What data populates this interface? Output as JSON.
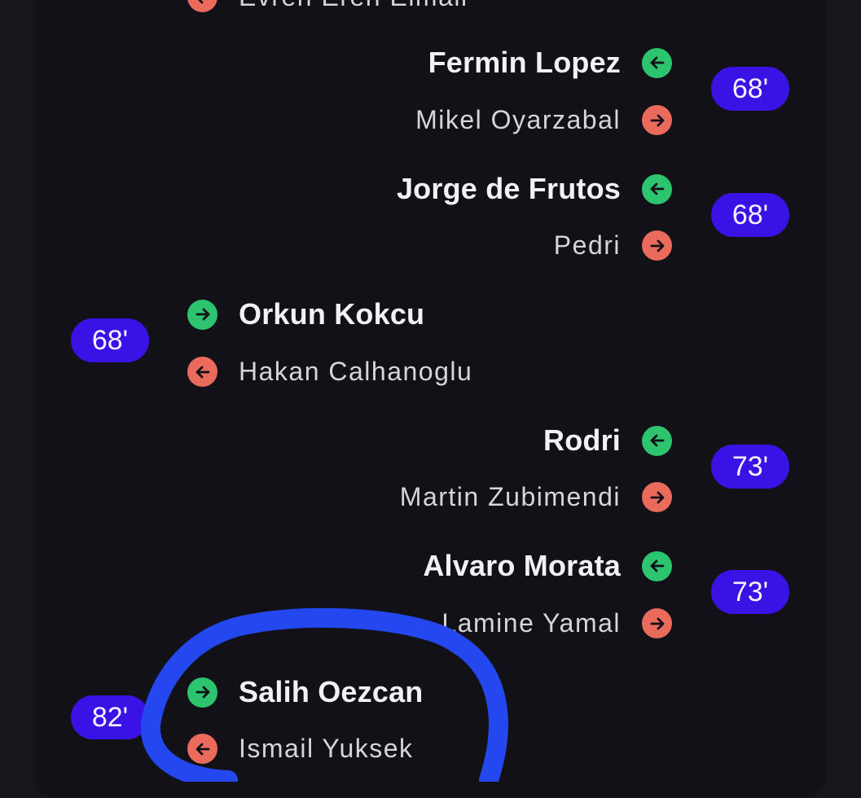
{
  "colors": {
    "in": "#2cc46f",
    "out": "#ea6b5b",
    "badge": "#3b12e6",
    "marker": "#2448f0"
  },
  "icons": {
    "in": "arrow-icon",
    "out": "arrow-icon"
  },
  "top_partial": {
    "name": "Evren Eren Elmali"
  },
  "substitutions": [
    {
      "minute": "68'",
      "in_player": "Fermin Lopez",
      "out_player": "Mikel Oyarzabal"
    },
    {
      "minute": "68'",
      "in_player": "Jorge de Frutos",
      "out_player": "Pedri"
    },
    {
      "minute": "68'",
      "in_player": "Orkun Kokcu",
      "out_player": "Hakan Calhanoglu"
    },
    {
      "minute": "73'",
      "in_player": "Rodri",
      "out_player": "Martin Zubimendi"
    },
    {
      "minute": "73'",
      "in_player": "Alvaro Morata",
      "out_player": "Lamine Yamal"
    },
    {
      "minute": "82'",
      "in_player": "Salih Oezcan",
      "out_player": "Ismail Yuksek"
    }
  ]
}
